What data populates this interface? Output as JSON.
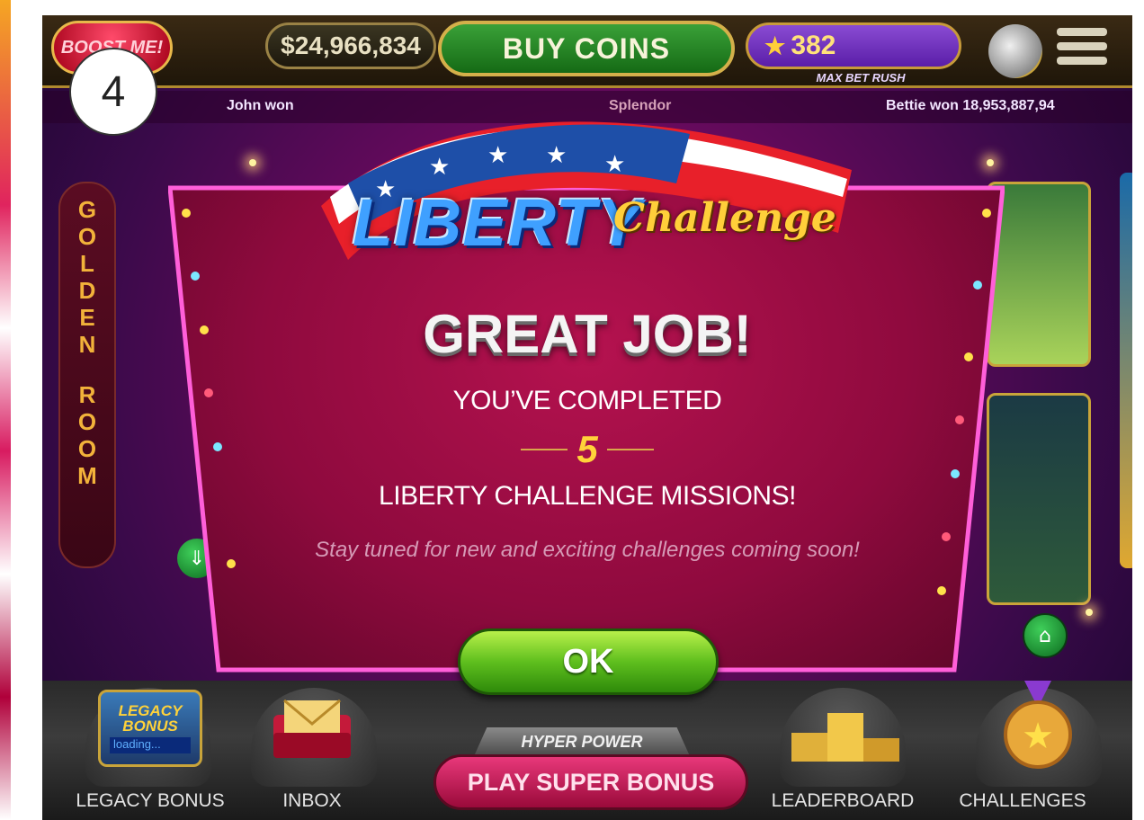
{
  "step_badge": "4",
  "top_bar": {
    "boost_label": "BOOST ME!",
    "balance": "$24,966,834",
    "buy_coins_label": "BUY COINS",
    "stars": "382",
    "max_bet_label": "MAX BET RUSH"
  },
  "ticker": {
    "left": "John won",
    "mid": "Splendor",
    "right": "Bettie won 18,953,887,94"
  },
  "side_panel": {
    "letters_top": [
      "G",
      "O",
      "L",
      "D",
      "E",
      "N"
    ],
    "letters_bottom": [
      "R",
      "O",
      "O",
      "M"
    ]
  },
  "dialog": {
    "banner_title": "LIBERTY",
    "banner_subtitle": "Challenge",
    "headline": "GREAT JOB!",
    "completed_line": "YOU’VE COMPLETED",
    "mission_count": "5",
    "missions_line": "LIBERTY CHALLENGE MISSIONS!",
    "stay_tuned": "Stay tuned for new and exciting challenges coming soon!",
    "ok_label": "OK"
  },
  "bottom_nav": {
    "legacy_icon_title": "LEGACY BONUS",
    "legacy_loading": "loading...",
    "legacy_label": "LEGACY BONUS",
    "inbox_label": "INBOX",
    "hyper_power_label": "HYPER POWER",
    "super_bonus_label": "PLAY SUPER BONUS",
    "leaderboard_label": "LEADERBOARD",
    "challenges_label": "CHALLENGES"
  },
  "colors": {
    "modal": "#8f0a3e",
    "ok_button": "#5fbf1e",
    "banner_title": "#3fa0ff",
    "banner_subtitle": "#ffcf3a",
    "mission_count": "#ffd23a"
  }
}
